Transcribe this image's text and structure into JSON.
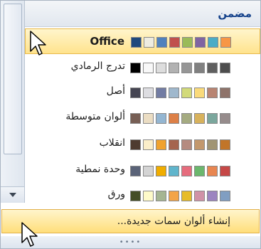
{
  "header": {
    "title": "مضمن"
  },
  "themes": [
    {
      "name": "Office",
      "colors": [
        "#1f497d",
        "#eeece1",
        "#4f81bd",
        "#c0504d",
        "#9bbb59",
        "#8064a2",
        "#4bacc6",
        "#f79646"
      ]
    },
    {
      "name": "تدرج الرمادي",
      "colors": [
        "#000000",
        "#f8f8f8",
        "#dddddd",
        "#b2b2b2",
        "#969696",
        "#808080",
        "#5f5f5f",
        "#4d4d4d"
      ]
    },
    {
      "name": "أصل",
      "colors": [
        "#464653",
        "#dddde1",
        "#727ca3",
        "#9fb8cd",
        "#d2da7a",
        "#fada7a",
        "#b88472",
        "#8e736a"
      ]
    },
    {
      "name": "ألوان متوسطة",
      "colors": [
        "#775f55",
        "#ebddc3",
        "#94b6d2",
        "#dd8047",
        "#a5ab81",
        "#d8b25c",
        "#7ba79d",
        "#968c8c"
      ]
    },
    {
      "name": "انقلاب",
      "colors": [
        "#4e3b30",
        "#fbeec9",
        "#f0a22e",
        "#a5644e",
        "#b58b80",
        "#c3986d",
        "#a19574",
        "#c17529"
      ]
    },
    {
      "name": "وحدة نمطية",
      "colors": [
        "#5a6378",
        "#d4d4d4",
        "#f0ad00",
        "#60b5cc",
        "#e66c7d",
        "#6bb76d",
        "#e88651",
        "#c64847"
      ]
    },
    {
      "name": "ورق",
      "colors": [
        "#444d26",
        "#fefac9",
        "#a5b592",
        "#f3a447",
        "#e7bc29",
        "#d092a7",
        "#9c85c0",
        "#809ec2"
      ]
    }
  ],
  "footer": {
    "create_label": "إنشاء ألوان سمات جديدة..."
  },
  "colors": {
    "header_text": "#15428b",
    "highlight": "#ffe38d"
  }
}
